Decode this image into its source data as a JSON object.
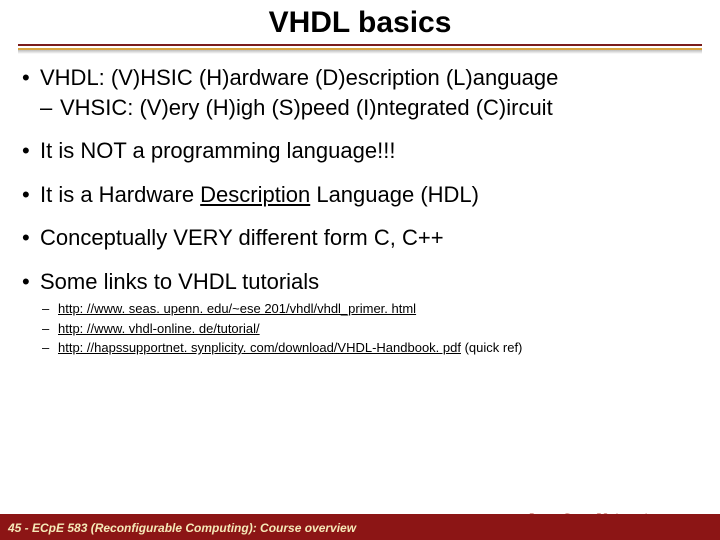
{
  "title": "VHDL basics",
  "bullets": [
    {
      "text": "VHDL: (V)HSIC (H)ardware (D)escription (L)anguage",
      "sub": [
        "VHSIC: (V)ery (H)igh (S)peed (I)ntegrated (C)ircuit"
      ]
    },
    {
      "text": "It is NOT a programming language!!!"
    },
    {
      "pre": "It is a Hardware ",
      "underlined": "Description",
      "post": " Language (HDL)"
    },
    {
      "text": "Conceptually VERY different form C, C++"
    },
    {
      "text": "Some links to VHDL tutorials",
      "links": [
        {
          "url": "http: //www. seas. upenn. edu/~ese 201/vhdl/vhdl_primer. html"
        },
        {
          "url": "http: //www. vhdl-online. de/tutorial/"
        },
        {
          "url": "http: //hapssupportnet. synplicity. com/download/VHDL-Handbook. pdf",
          "note": " (quick ref)"
        }
      ]
    }
  ],
  "footer": {
    "text": "45 - ECpE 583 (Reconfigurable Computing): Course overview",
    "university": "Iowa State University"
  }
}
